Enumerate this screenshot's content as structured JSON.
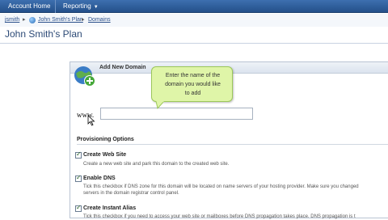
{
  "topnav": {
    "account_home": "Account Home",
    "reporting": "Reporting"
  },
  "breadcrumb": {
    "item1": "jsmith",
    "item2": "John Smith's Plan",
    "item3": "Domains"
  },
  "page": {
    "title": "John Smith's Plan"
  },
  "panel": {
    "header": "Add New Domain",
    "www_label": "www.",
    "domain_value": "",
    "tooltip_line1": "Enter the name of the",
    "tooltip_line2": "domain you would like",
    "tooltip_line3": "to add"
  },
  "provisioning": {
    "title": "Provisioning Options",
    "options": [
      {
        "label": "Create Web Site",
        "checked": true,
        "desc1": "Create a new web site and park this domain to the created web site.",
        "desc2": ""
      },
      {
        "label": "Enable DNS",
        "checked": true,
        "desc1": "Tick this checkbox if DNS zone for this domain will be located on name servers of your hosting provider. Make sure you changed",
        "desc2": "servers in the domain registrar control panel."
      },
      {
        "label": "Create Instant Alias",
        "checked": true,
        "desc1": "Tick this checkbox if you need to access your web site or mailboxes before DNS propagation takes place. DNS propagation is t",
        "desc2": ""
      }
    ]
  },
  "colors": {
    "nav_bg": "#2e5e9c",
    "tooltip_bg": "#dff5a8",
    "title_color": "#2c4a76"
  }
}
